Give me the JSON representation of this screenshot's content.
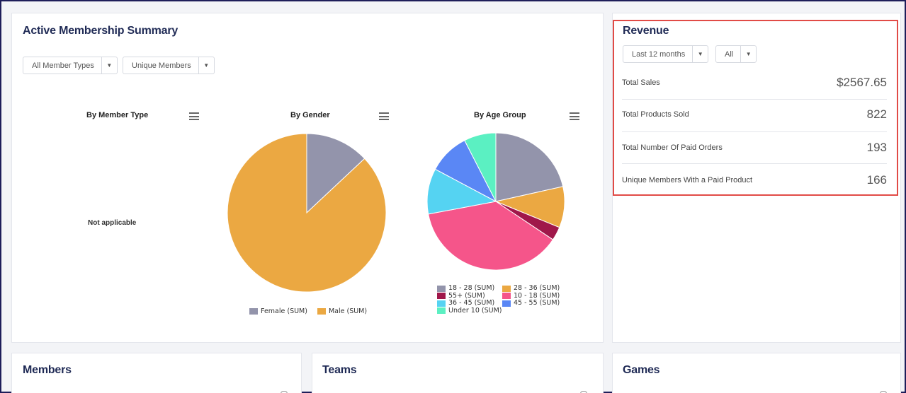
{
  "membership": {
    "title": "Active Membership Summary",
    "filters": {
      "member_type": "All Member Types",
      "count_mode": "Unique Members"
    },
    "charts": {
      "by_member_type": {
        "title": "By Member Type",
        "placeholder": "Not applicable"
      },
      "by_gender": {
        "title": "By Gender"
      },
      "by_age_group": {
        "title": "By Age Group"
      }
    }
  },
  "chart_data": [
    {
      "type": "pie",
      "title": "By Gender",
      "series": [
        {
          "name": "Female (SUM)",
          "value": 13,
          "color": "#9394ab"
        },
        {
          "name": "Male (SUM)",
          "value": 87,
          "color": "#eba842"
        }
      ]
    },
    {
      "type": "pie",
      "title": "By Age Group",
      "series": [
        {
          "name": "18 - 28 (SUM)",
          "value": 20,
          "color": "#9394ab"
        },
        {
          "name": "28 - 36 (SUM)",
          "value": 9,
          "color": "#eba842"
        },
        {
          "name": "55+ (SUM)",
          "value": 3,
          "color": "#a0174a"
        },
        {
          "name": "10 - 18 (SUM)",
          "value": 35,
          "color": "#f5558a"
        },
        {
          "name": "36 - 45 (SUM)",
          "value": 10,
          "color": "#55d3f2"
        },
        {
          "name": "45 - 55 (SUM)",
          "value": 9,
          "color": "#5a87f5"
        },
        {
          "name": "Under 10 (SUM)",
          "value": 7,
          "color": "#5bf0c2"
        }
      ]
    }
  ],
  "revenue": {
    "title": "Revenue",
    "filters": {
      "period": "Last 12 months",
      "scope": "All"
    },
    "rows": [
      {
        "label": "Total Sales",
        "value": "$2567.65"
      },
      {
        "label": "Total Products Sold",
        "value": "822"
      },
      {
        "label": "Total Number Of Paid Orders",
        "value": "193"
      },
      {
        "label": "Unique Members With a Paid Product",
        "value": "166"
      }
    ]
  },
  "bottom": {
    "members_title": "Members",
    "teams_title": "Teams",
    "games_title": "Games"
  }
}
